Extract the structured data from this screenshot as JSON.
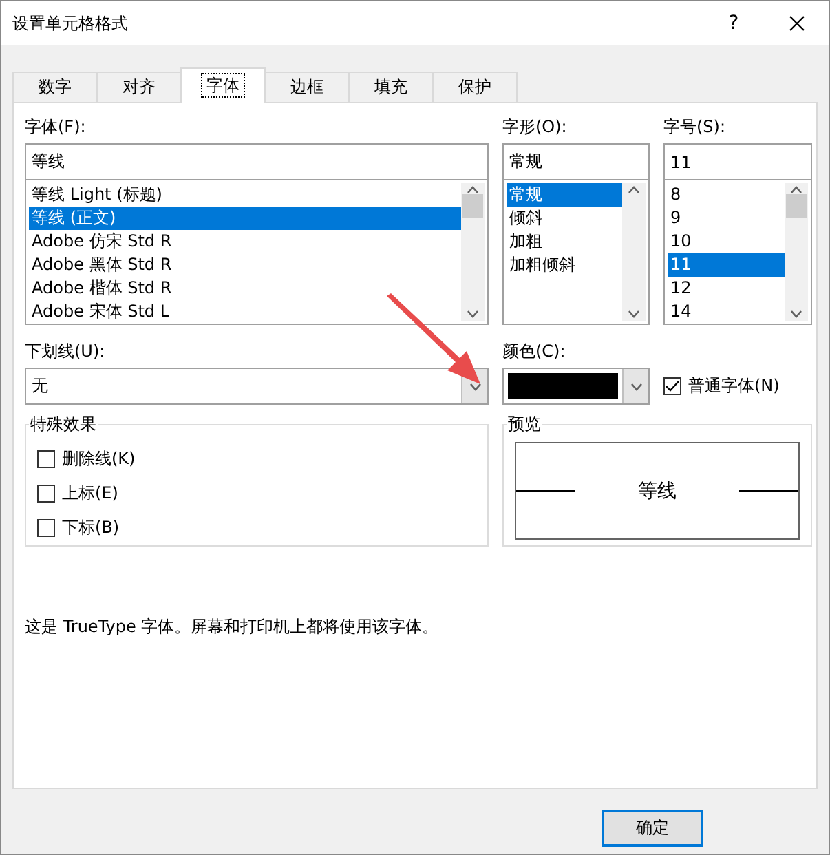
{
  "window": {
    "title": "设置单元格格式",
    "help": "?"
  },
  "tabs": [
    {
      "label": "数字",
      "selected": false
    },
    {
      "label": "对齐",
      "selected": false
    },
    {
      "label": "字体",
      "selected": true
    },
    {
      "label": "边框",
      "selected": false
    },
    {
      "label": "填充",
      "selected": false
    },
    {
      "label": "保护",
      "selected": false
    }
  ],
  "font": {
    "label": "字体(F):",
    "value": "等线",
    "items": [
      {
        "label": "等线 Light (标题)",
        "selected": false
      },
      {
        "label": "等线 (正文)",
        "selected": true
      },
      {
        "label": "Adobe 仿宋 Std R",
        "selected": false
      },
      {
        "label": "Adobe 黑体 Std R",
        "selected": false
      },
      {
        "label": "Adobe 楷体 Std R",
        "selected": false
      },
      {
        "label": "Adobe 宋体 Std L",
        "selected": false
      }
    ]
  },
  "style": {
    "label": "字形(O):",
    "value": "常规",
    "items": [
      {
        "label": "常规",
        "selected": true
      },
      {
        "label": "倾斜",
        "selected": false
      },
      {
        "label": "加粗",
        "selected": false
      },
      {
        "label": "加粗倾斜",
        "selected": false
      }
    ]
  },
  "size": {
    "label": "字号(S):",
    "value": "11",
    "items": [
      {
        "label": "8",
        "selected": false
      },
      {
        "label": "9",
        "selected": false
      },
      {
        "label": "10",
        "selected": false
      },
      {
        "label": "11",
        "selected": true
      },
      {
        "label": "12",
        "selected": false
      },
      {
        "label": "14",
        "selected": false
      }
    ]
  },
  "underline": {
    "label": "下划线(U):",
    "value": "无"
  },
  "color": {
    "label": "颜色(C):",
    "color": "#000000"
  },
  "normal_font": {
    "label": "普通字体(N)",
    "checked": true
  },
  "effects": {
    "title": "特殊效果",
    "items": [
      {
        "label": "删除线(K)",
        "checked": false
      },
      {
        "label": "上标(E)",
        "checked": false
      },
      {
        "label": "下标(B)",
        "checked": false
      }
    ]
  },
  "preview": {
    "title": "预览",
    "sample": "等线"
  },
  "info": "这是 TrueType 字体。屏幕和打印机上都将使用该字体。",
  "buttons": [
    {
      "label": "确定",
      "default": true
    }
  ]
}
